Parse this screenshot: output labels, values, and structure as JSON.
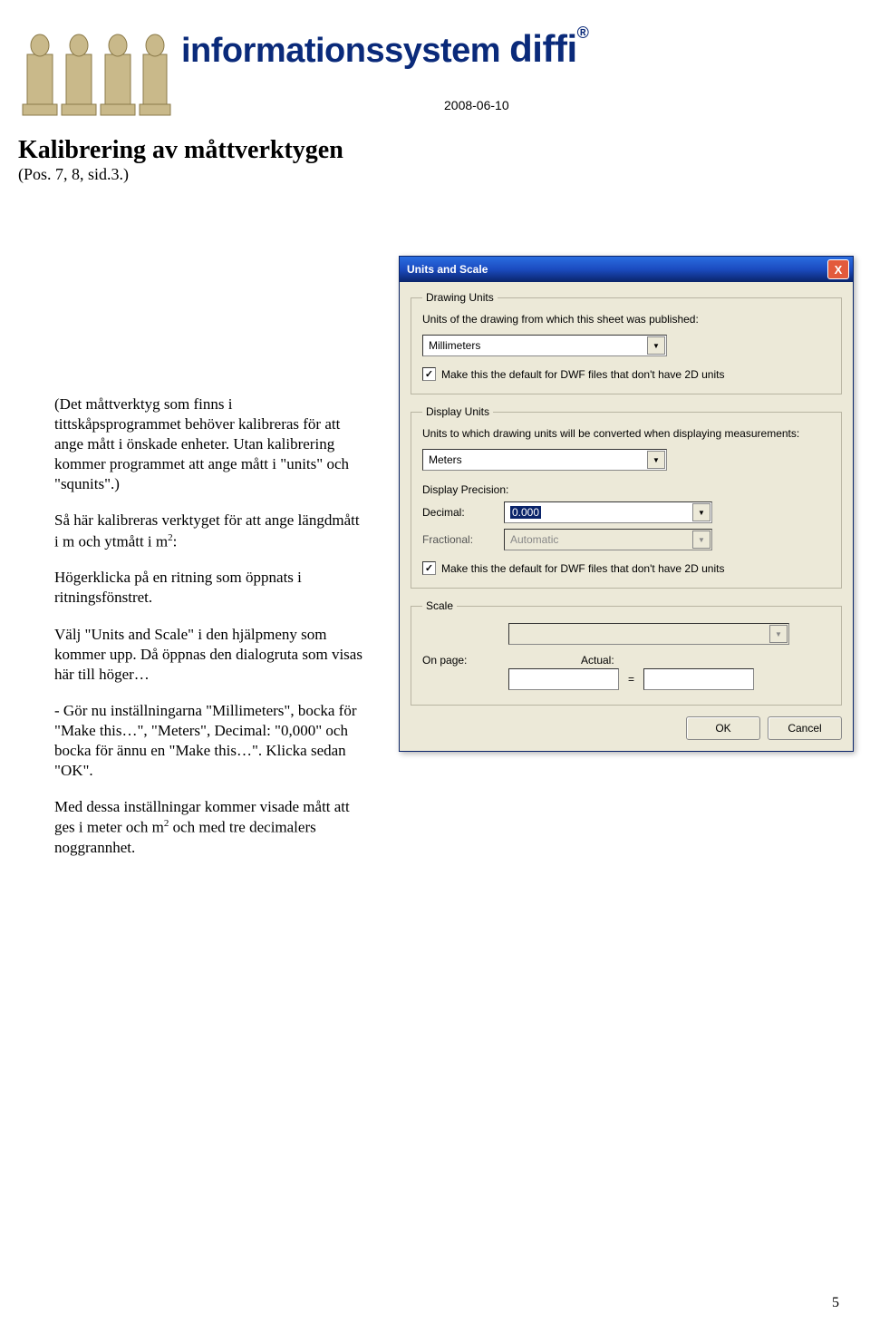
{
  "header": {
    "brand_prefix": "informationssystem ",
    "brand_main": "diffi",
    "brand_reg": "®",
    "title": "Kalibrering av måttverktygen",
    "subtitle": "(Pos. 7, 8, sid.3.)",
    "date": "2008-06-10"
  },
  "body": {
    "p1": "(Det måttverktyg som finns i tittskåpsprogrammet behöver kalibreras för att ange mått i önskade enheter. Utan kalibrering kommer programmet att ange mått i \"units\" och \"squnits\".)",
    "p2a": "Så här kalibreras verktyget för att ange längdmått i m och ytmått i m",
    "p2sup": "2",
    "p2b": ":",
    "p3": "Högerklicka på en ritning som öppnats i ritningsfönstret.",
    "p4": "Välj \"Units and Scale\" i den hjälpmeny som kommer upp. Då öppnas den dialogruta som visas här till höger…",
    "p5": " - Gör nu inställningarna \"Millimeters\", bocka för \"Make this…\", \"Meters\", Decimal: \"0,000\" och bocka för ännu en \"Make this…\". Klicka sedan \"OK\".",
    "p6a": "Med dessa inställningar kommer visade mått att ges i meter och m",
    "p6sup": "2",
    "p6b": " och med tre decimalers noggrannhet."
  },
  "dialog": {
    "title": "Units and Scale",
    "close": "X",
    "drawing": {
      "legend": "Drawing Units",
      "desc": "Units of the drawing from which this sheet was published:",
      "units": "Millimeters",
      "default_label": "Make this the default for DWF files that don't have 2D units",
      "default_checked": true
    },
    "display": {
      "legend": "Display Units",
      "desc": "Units to which drawing units will be converted when displaying measurements:",
      "units": "Meters",
      "precision_label": "Display Precision:",
      "decimal_label": "Decimal:",
      "decimal_value": "0.000",
      "fractional_label": "Fractional:",
      "fractional_value": "Automatic",
      "default_label": "Make this the default for DWF files that don't have 2D units",
      "default_checked": true
    },
    "scale": {
      "legend": "Scale",
      "onpage": "On page:",
      "actual": "Actual:",
      "equals": "="
    },
    "buttons": {
      "ok": "OK",
      "cancel": "Cancel"
    }
  },
  "page_number": "5"
}
